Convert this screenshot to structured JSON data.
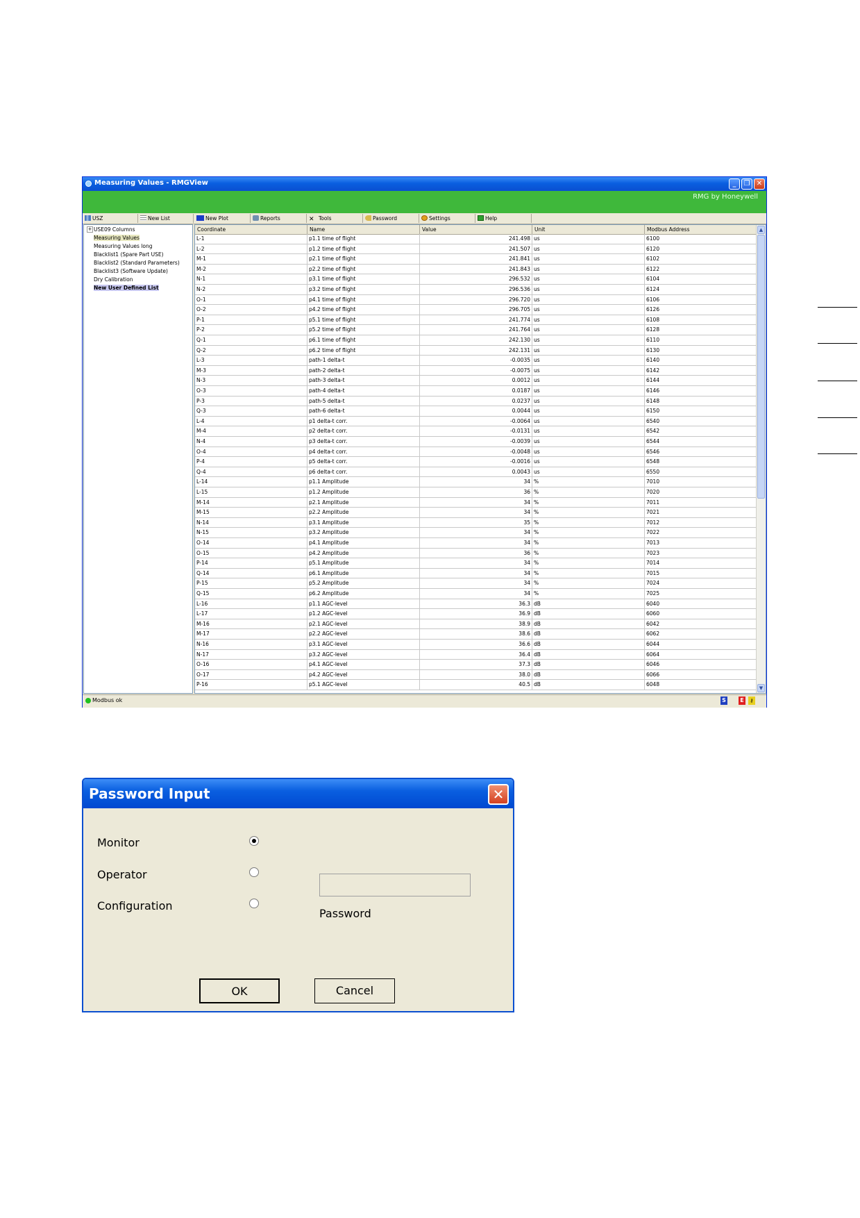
{
  "window": {
    "title": "Measuring Values - RMGView",
    "brand": "RMG by Honeywell",
    "buttons": {
      "minimize": "_",
      "restore": "❐",
      "close": "✕"
    }
  },
  "toolbar": {
    "items": [
      "USZ",
      "New List",
      "New Plot",
      "Reports",
      "Tools",
      "Password",
      "Settings",
      "Help"
    ]
  },
  "tree": {
    "items": [
      {
        "label": "USE09 Columns",
        "expander": "+"
      },
      {
        "label": "Measuring Values"
      },
      {
        "label": "Measuring Values long"
      },
      {
        "label": "Blacklist1 (Spare Part USE)"
      },
      {
        "label": "Blacklist2 (Standard Parameters)"
      },
      {
        "label": "Blacklist3 (Software Update)"
      },
      {
        "label": "Dry Calibration"
      },
      {
        "label": "New User Defined List"
      }
    ]
  },
  "grid": {
    "columns": [
      "Coordinate",
      "Name",
      "Value",
      "Unit",
      "Modbus Address"
    ],
    "rows": [
      [
        "L-1",
        "p1.1 time of flight",
        "241.498",
        "us",
        "6100"
      ],
      [
        "L-2",
        "p1.2 time of flight",
        "241.507",
        "us",
        "6120"
      ],
      [
        "M-1",
        "p2.1 time of flight",
        "241.841",
        "us",
        "6102"
      ],
      [
        "M-2",
        "p2.2 time of flight",
        "241.843",
        "us",
        "6122"
      ],
      [
        "N-1",
        "p3.1 time of flight",
        "296.532",
        "us",
        "6104"
      ],
      [
        "N-2",
        "p3.2 time of flight",
        "296.536",
        "us",
        "6124"
      ],
      [
        "O-1",
        "p4.1 time of flight",
        "296.720",
        "us",
        "6106"
      ],
      [
        "O-2",
        "p4.2 time of flight",
        "296.705",
        "us",
        "6126"
      ],
      [
        "P-1",
        "p5.1 time of flight",
        "241.774",
        "us",
        "6108"
      ],
      [
        "P-2",
        "p5.2 time of flight",
        "241.764",
        "us",
        "6128"
      ],
      [
        "Q-1",
        "p6.1 time of flight",
        "242.130",
        "us",
        "6110"
      ],
      [
        "Q-2",
        "p6.2 time of flight",
        "242.131",
        "us",
        "6130"
      ],
      [
        "L-3",
        "path-1 delta-t",
        "-0.0035",
        "us",
        "6140"
      ],
      [
        "M-3",
        "path-2 delta-t",
        "-0.0075",
        "us",
        "6142"
      ],
      [
        "N-3",
        "path-3 delta-t",
        "0.0012",
        "us",
        "6144"
      ],
      [
        "O-3",
        "path-4 delta-t",
        "0.0187",
        "us",
        "6146"
      ],
      [
        "P-3",
        "path-5 delta-t",
        "0.0237",
        "us",
        "6148"
      ],
      [
        "Q-3",
        "path-6 delta-t",
        "0.0044",
        "us",
        "6150"
      ],
      [
        "L-4",
        "p1 delta-t corr.",
        "-0.0064",
        "us",
        "6540"
      ],
      [
        "M-4",
        "p2 delta-t corr.",
        "-0.0131",
        "us",
        "6542"
      ],
      [
        "N-4",
        "p3 delta-t corr.",
        "-0.0039",
        "us",
        "6544"
      ],
      [
        "O-4",
        "p4 delta-t corr.",
        "-0.0048",
        "us",
        "6546"
      ],
      [
        "P-4",
        "p5 delta-t corr.",
        "-0.0016",
        "us",
        "6548"
      ],
      [
        "Q-4",
        "p6 delta-t corr.",
        "0.0043",
        "us",
        "6550"
      ],
      [
        "L-14",
        "p1.1 Amplitude",
        "34",
        "%",
        "7010"
      ],
      [
        "L-15",
        "p1.2 Amplitude",
        "36",
        "%",
        "7020"
      ],
      [
        "M-14",
        "p2.1 Amplitude",
        "34",
        "%",
        "7011"
      ],
      [
        "M-15",
        "p2.2 Amplitude",
        "34",
        "%",
        "7021"
      ],
      [
        "N-14",
        "p3.1 Amplitude",
        "35",
        "%",
        "7012"
      ],
      [
        "N-15",
        "p3.2 Amplitude",
        "34",
        "%",
        "7022"
      ],
      [
        "O-14",
        "p4.1 Amplitude",
        "34",
        "%",
        "7013"
      ],
      [
        "O-15",
        "p4.2 Amplitude",
        "36",
        "%",
        "7023"
      ],
      [
        "P-14",
        "p5.1 Amplitude",
        "34",
        "%",
        "7014"
      ],
      [
        "Q-14",
        "p6.1 Amplitude",
        "34",
        "%",
        "7015"
      ],
      [
        "P-15",
        "p5.2 Amplitude",
        "34",
        "%",
        "7024"
      ],
      [
        "Q-15",
        "p6.2 Amplitude",
        "34",
        "%",
        "7025"
      ],
      [
        "L-16",
        "p1.1 AGC-level",
        "36.3",
        "dB",
        "6040"
      ],
      [
        "L-17",
        "p1.2 AGC-level",
        "36.9",
        "dB",
        "6060"
      ],
      [
        "M-16",
        "p2.1 AGC-level",
        "38.9",
        "dB",
        "6042"
      ],
      [
        "M-17",
        "p2.2 AGC-level",
        "38.6",
        "dB",
        "6062"
      ],
      [
        "N-16",
        "p3.1 AGC-level",
        "36.6",
        "dB",
        "6044"
      ],
      [
        "N-17",
        "p3.2 AGC-level",
        "36.4",
        "dB",
        "6064"
      ],
      [
        "O-16",
        "p4.1 AGC-level",
        "37.3",
        "dB",
        "6046"
      ],
      [
        "O-17",
        "p4.2 AGC-level",
        "38.0",
        "dB",
        "6066"
      ],
      [
        "P-16",
        "p5.1 AGC-level",
        "40.5",
        "dB",
        "6048"
      ]
    ]
  },
  "status": {
    "text": "Modbus ok",
    "indicators": [
      "S",
      "E"
    ]
  },
  "dialog": {
    "title": "Password Input",
    "close": "✕",
    "options": [
      {
        "label": "Monitor",
        "selected": true
      },
      {
        "label": "Operator",
        "selected": false
      },
      {
        "label": "Configuration",
        "selected": false
      }
    ],
    "password_value": "",
    "password_label": "Password",
    "ok": "OK",
    "cancel": "Cancel"
  }
}
